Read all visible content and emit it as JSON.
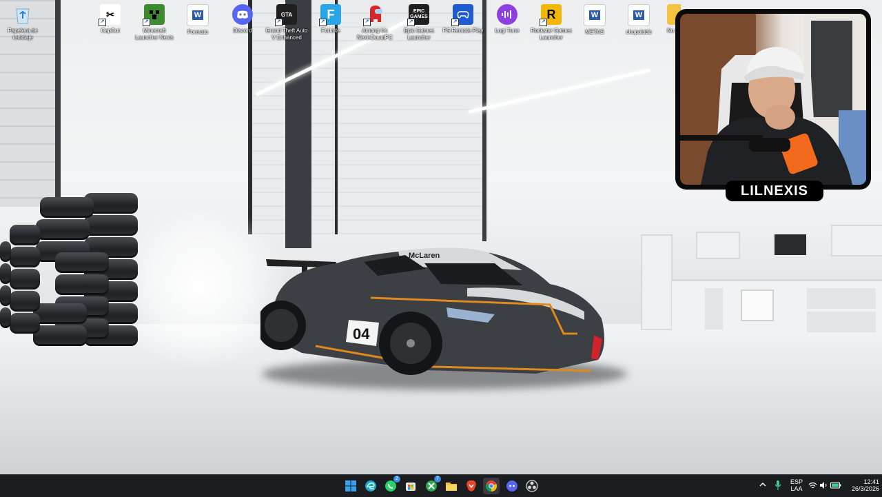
{
  "desktop": {
    "icons": [
      {
        "label": "Papelera de reciclaje",
        "icon": "recycle-bin-icon",
        "color": "#9ec7e8"
      },
      {
        "label": "CapCut",
        "icon": "capcut-icon",
        "color": "#ffffff"
      },
      {
        "label": "Minecraft Launcher Nexis",
        "icon": "minecraft-icon",
        "color": "#3e8a2e"
      },
      {
        "label": "Formato",
        "icon": "word-doc-icon",
        "color": "#2b5cab"
      },
      {
        "label": "Discord",
        "icon": "discord-icon",
        "color": "#5865f2"
      },
      {
        "label": "Grand Theft Auto V Enhanced",
        "icon": "gta-icon",
        "color": "#1f1f1f"
      },
      {
        "label": "Fortnite",
        "icon": "fortnite-icon",
        "color": "#2aa6e8"
      },
      {
        "label": "Among Us NexisDavidPC",
        "icon": "among-us-icon",
        "color": "#d9262a"
      },
      {
        "label": "Epic Games Launcher",
        "icon": "epic-games-icon",
        "color": "#202020"
      },
      {
        "label": "PS Remote Play",
        "icon": "ps-remote-play-icon",
        "color": "#1f5bd1"
      },
      {
        "label": "Logi Tune",
        "icon": "logi-tune-icon",
        "color": "#8e3fe0"
      },
      {
        "label": "Rockstar Games Launcher",
        "icon": "rockstar-icon",
        "color": "#f2b705"
      },
      {
        "label": "METAS",
        "icon": "word-doc-icon",
        "color": "#2b5cab"
      },
      {
        "label": "chupalobb",
        "icon": "word-doc-icon",
        "color": "#2b5cab"
      },
      {
        "label": "Nu",
        "icon": "folder-icon",
        "color": "#f3c340"
      }
    ]
  },
  "webcam": {
    "streamer_name": "LILNEXIS"
  },
  "taskbar": {
    "apps": [
      {
        "name": "start",
        "icon": "windows-start-icon",
        "color": "#3aa0f2",
        "badge": ""
      },
      {
        "name": "edge",
        "icon": "edge-icon",
        "color": "#1fa3d6",
        "badge": ""
      },
      {
        "name": "whatsapp",
        "icon": "whatsapp-icon",
        "color": "#25d366",
        "badge": "2"
      },
      {
        "name": "store",
        "icon": "store-icon",
        "color": "#e8e8e8",
        "badge": ""
      },
      {
        "name": "xbox",
        "icon": "xbox-icon",
        "color": "#2fa84f",
        "badge": "7"
      },
      {
        "name": "file-explorer",
        "icon": "folder-icon",
        "color": "#f3c340",
        "badge": ""
      },
      {
        "name": "brave",
        "icon": "brave-icon",
        "color": "#e8462b",
        "badge": ""
      },
      {
        "name": "chrome",
        "icon": "chrome-icon",
        "color": "#e8c22b",
        "badge": ""
      },
      {
        "name": "discord",
        "icon": "discord-icon",
        "color": "#5865f2",
        "badge": ""
      },
      {
        "name": "obs",
        "icon": "obs-icon",
        "color": "#d9d9d9",
        "badge": ""
      }
    ],
    "active_app": "chrome",
    "tray": {
      "language_top": "ESP",
      "language_bottom": "LAA",
      "time": "12:41",
      "date": "26/3/2026"
    }
  }
}
